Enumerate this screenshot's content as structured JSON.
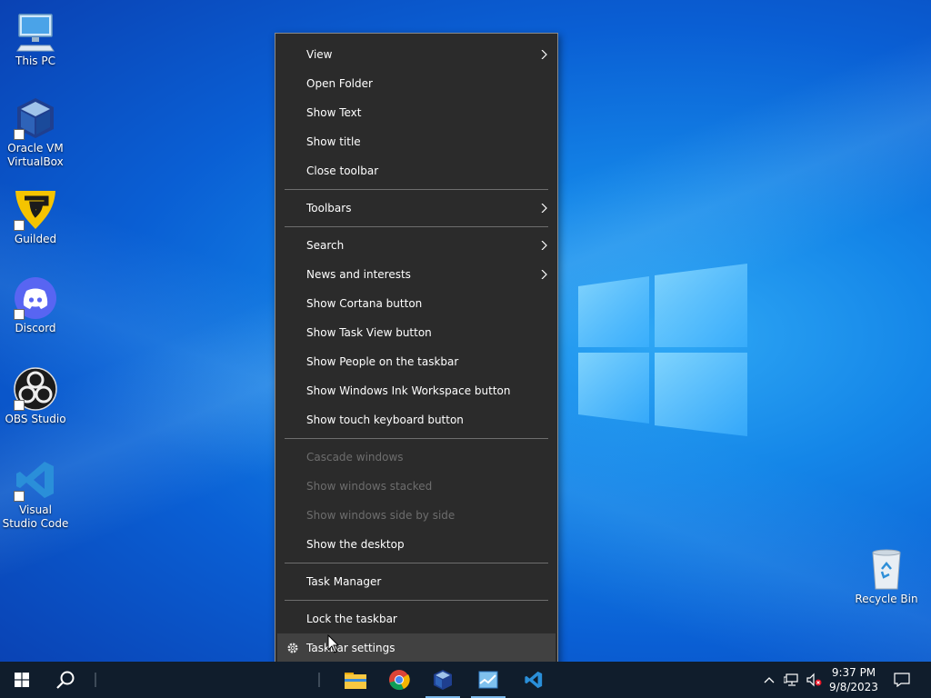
{
  "desktop": {
    "icons": [
      {
        "label": "This PC"
      },
      {
        "label": "Oracle VM VirtualBox"
      },
      {
        "label": "Guilded"
      },
      {
        "label": "Discord"
      },
      {
        "label": "OBS Studio"
      },
      {
        "label": "Visual Studio Code"
      },
      {
        "label": "Recycle Bin"
      }
    ]
  },
  "menu": {
    "group1": [
      "View",
      "Open Folder",
      "Show Text",
      "Show title",
      "Close toolbar"
    ],
    "group2": [
      "Toolbars"
    ],
    "group3": [
      "Search",
      "News and interests",
      "Show Cortana button",
      "Show Task View button",
      "Show People on the taskbar",
      "Show Windows Ink Workspace button",
      "Show touch keyboard button"
    ],
    "group4": [
      "Cascade windows",
      "Show windows stacked",
      "Show windows side by side",
      "Show the desktop"
    ],
    "group5": [
      "Task Manager"
    ],
    "group6": [
      "Lock the taskbar",
      "Taskbar settings"
    ]
  },
  "taskbar": {
    "time": "9:37 PM",
    "date": "9/8/2023",
    "pinned": [
      "File Explorer",
      "Google Chrome",
      "Oracle VM VirtualBox",
      "Task Manager",
      "Visual Studio Code"
    ]
  },
  "colors": {
    "menu_bg": "#2b2b2b",
    "menu_hover": "#414141",
    "taskbar_bg": "#101d2c",
    "accent": "#7cb8ea"
  }
}
